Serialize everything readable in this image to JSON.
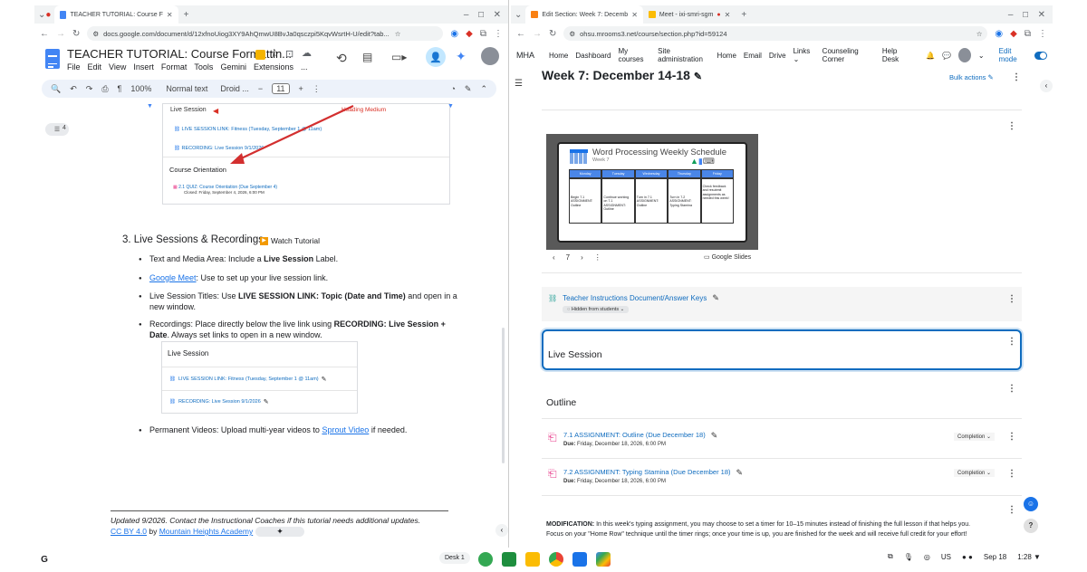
{
  "left_browser": {
    "tab_title": "TEACHER TUTORIAL: Course F",
    "url": "docs.google.com/document/d/12xfnoUiog3XY9AhQmwU8BvJa0qsczpi5KqvWsrtH-U/edit?tab...",
    "doc_title": "TEACHER TUTORIAL: Course Formattin...",
    "menu": [
      "File",
      "Edit",
      "View",
      "Insert",
      "Format",
      "Tools",
      "Gemini",
      "Extensions",
      "..."
    ],
    "zoom": "100%",
    "style": "Normal text",
    "font": "Droid ...",
    "font_size": "11",
    "outline_count": "4"
  },
  "doc": {
    "top_card": {
      "live_session_label": "Live Session",
      "heading_medium": "Heading Medium",
      "live_link": "LIVE SESSION LINK: Fitness (Tuesday, September 1 @ 11am)",
      "recording": "RECORDING: Live Session 9/1/2026",
      "course_orientation": "Course Orientation",
      "quiz": "2.1 QUIZ: Course Orientation (Due September 4)",
      "quiz_closed": "Closed: Friday, September 4, 2026, 6:00 PM"
    },
    "section_heading": "3.  Live Sessions & Recordings",
    "watch_tutorial": "Watch Tutorial",
    "b1_pre": "Text and Media Area: Include a ",
    "b1_bold": "Live Session",
    "b1_post": " Label.",
    "b2_link": "Google Meet",
    "b2_post": ": Use to set up your live session link.",
    "b3_pre": "Live Session Titles: Use ",
    "b3_bold": "LIVE SESSION LINK: Topic (Date and Time)",
    "b3_post": " and open in a",
    "b3_line2": "new window.",
    "b4_pre": "Recordings: Place directly below the live link using ",
    "b4_bold": "RECORDING: Live Session +",
    "b4_bold2": "Date",
    "b4_post": ". Always set links to open in a new window.",
    "inner_card": {
      "title": "Live Session",
      "live_link": "LIVE SESSION LINK: Fitness (Tuesday, September 1 @ 11am)",
      "recording": "RECORDING: Live Session 9/1/2026"
    },
    "b5_pre": "Permanent Videos: Upload multi-year videos to ",
    "b5_link": "Sprout Video",
    "b5_post": " if needed.",
    "footer_text": "Updated 9/2026. Contact the Instructional Coaches if this tutorial needs additional updates.",
    "footer_cc": "CC BY 4.0",
    "footer_by": " by ",
    "footer_mha": "Mountain Heights Academy"
  },
  "right_browser": {
    "tab1": "Edit Section: Week 7: Decemb",
    "tab2": "Meet - ixi-smri-sgm",
    "url": "ohsu.mrooms3.net/course/section.php?id=59124"
  },
  "moodle": {
    "brand": "MHA",
    "nav": [
      "Home",
      "Dashboard",
      "My courses",
      "Site administration",
      "Home",
      "Email",
      "Drive",
      "Links",
      "Counseling Corner",
      "Help Desk"
    ],
    "edit_mode": "Edit mode",
    "page_title": "Week 7: December 14-18",
    "bulk_actions": "Bulk actions",
    "slide_title": "Word Processing Weekly Schedule",
    "slide_sub": "Week 7",
    "slide_days": [
      "Monday",
      "Tuesday",
      "Wednesday",
      "Thursday",
      "Friday"
    ],
    "slide_cells": [
      "Begin 7.1 ASSIGNMENT: Outline",
      "Continue working on 7.1 ASSIGNMENT: Outline",
      "Turn in 7.1 ASSIGNMENT: Outline",
      "Turn in 7.2 ASSIGNMENT: Typing Stamina",
      "Check feedback and resubmit assignments as needed this week!"
    ],
    "slide_page": "7",
    "google_slides": "Google Slides",
    "teacher_doc": "Teacher Instructions Document/Answer Keys",
    "hidden_badge": "Hidden from students",
    "live_session": "Live Session",
    "outline": "Outline",
    "a1_title": "7.1 ASSIGNMENT: Outline (Due December 18)",
    "a1_due": "Friday, December 18, 2026, 6:00 PM",
    "a2_title": "7.2 ASSIGNMENT: Typing Stamina (Due December 18)",
    "a2_due": "Friday, December 18, 2026, 6:00 PM",
    "due_label": "Due:",
    "completion": "Completion",
    "mod_bold": "MODIFICATION:",
    "mod_text": " In this week's typing assignment, you may choose to set a timer for 10–15 minutes instead of finishing the full lesson if that helps you.",
    "mod_text2": "Focus on your \"Home Row\" technique until the timer rings; once your time is up, you are finished for the week and will receive full credit for your effort!"
  },
  "shelf": {
    "desk": "Desk 1",
    "ime": "US",
    "date": "Sep 18",
    "time": "1:28"
  }
}
